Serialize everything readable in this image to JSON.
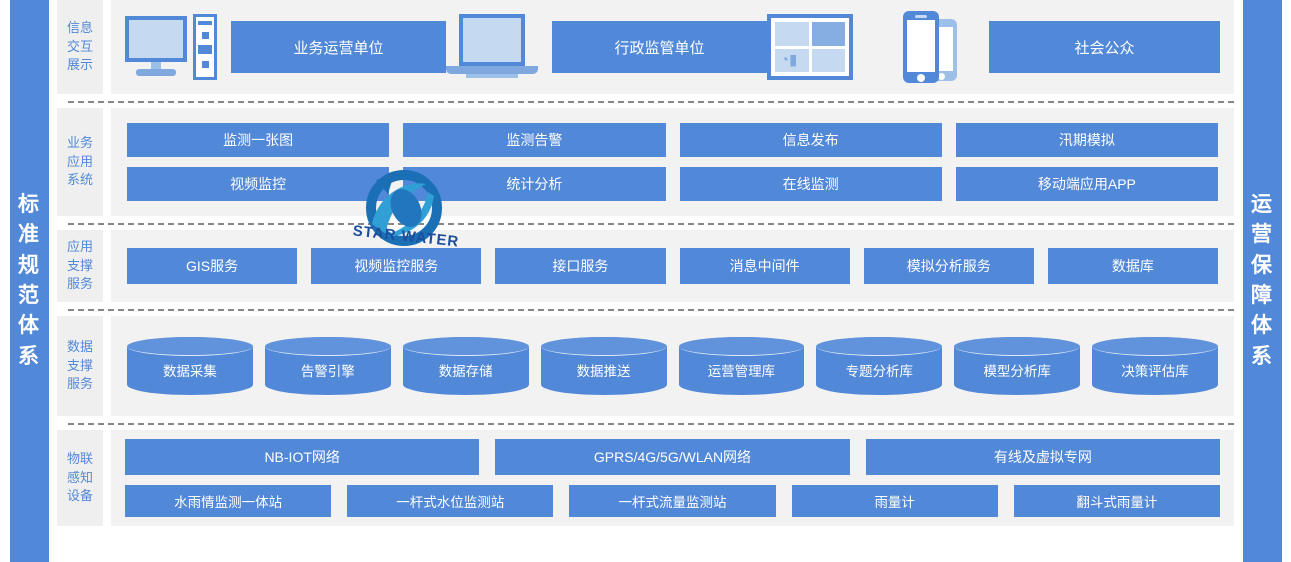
{
  "side_banners": {
    "left": {
      "name": "standard-spec-system",
      "chars": [
        "标",
        "准",
        "规",
        "范",
        "体",
        "系"
      ]
    },
    "right": {
      "name": "operation-guarantee-system",
      "chars": [
        "运",
        "营",
        "保",
        "障",
        "体",
        "系"
      ]
    }
  },
  "watermark": {
    "text": "STAR WATER",
    "icon": "star-water-logo-icon"
  },
  "colors": {
    "accent_blue": "#5288d8",
    "chip_blue": "#5288d8",
    "panel_gray": "#f2f2f2",
    "label_gray": "#efefef",
    "icon_light_blue": "#c5d9f1",
    "separator": "#868686"
  },
  "rows": [
    {
      "id": "info-interaction-display",
      "label": [
        "信",
        "息",
        "交",
        "互",
        "展",
        "示"
      ],
      "label_lines": [
        "信息",
        "交互",
        "展示"
      ],
      "groups": [
        {
          "icon": "desktop-computer-icon",
          "label": "业务运营单位"
        },
        {
          "icon": "laptop-icon",
          "label": "行政监管单位"
        },
        {
          "icon": "dashboard-screen-icon",
          "label": ""
        },
        {
          "icon": "mobile-phone-icon",
          "label": "社会公众"
        }
      ],
      "chips": [
        "业务运营单位",
        "行政监管单位",
        "社会公众"
      ]
    },
    {
      "id": "business-application-system",
      "label_lines": [
        "业务",
        "应用",
        "系统"
      ],
      "line1": [
        "监测一张图",
        "监测告警",
        "信息发布",
        "汛期模拟"
      ],
      "line2": [
        "视频监控",
        "统计分析",
        "在线监测",
        "移动端应用APP"
      ]
    },
    {
      "id": "application-support-service",
      "label_lines": [
        "应用",
        "支撑",
        "服务"
      ],
      "items": [
        "GIS服务",
        "视频监控服务",
        "接口服务",
        "消息中间件",
        "模拟分析服务",
        "数据库"
      ]
    },
    {
      "id": "data-support-service",
      "label_lines": [
        "数据",
        "支撑",
        "服务"
      ],
      "items": [
        "数据采集",
        "告警引擎",
        "数据存储",
        "数据推送",
        "运营管理库",
        "专题分析库",
        "模型分析库",
        "决策评估库"
      ]
    },
    {
      "id": "iot-sensing-device",
      "label_lines": [
        "物联",
        "感知",
        "设备"
      ],
      "networks": [
        "NB-IOT网络",
        "GPRS/4G/5G/WLAN网络",
        "有线及虚拟专网"
      ],
      "devices": [
        "水雨情监测一体站",
        "一杆式水位监测站",
        "一杆式流量监测站",
        "雨量计",
        "翻斗式雨量计"
      ]
    }
  ]
}
